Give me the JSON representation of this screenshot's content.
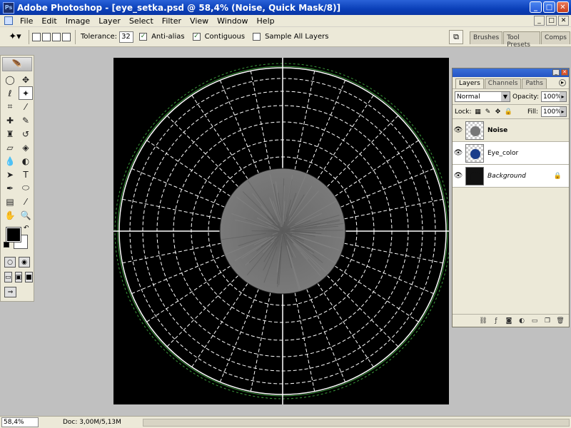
{
  "window": {
    "title": "Adobe Photoshop - [eye_setka.psd @ 58,4% (Noise, Quick Mask/8)]",
    "app_icon": "Ps",
    "minimize": "_",
    "maximize": "□",
    "close": "✕"
  },
  "menu": [
    "File",
    "Edit",
    "Image",
    "Layer",
    "Select",
    "Filter",
    "View",
    "Window",
    "Help"
  ],
  "doc_window_btns": [
    "_",
    "□",
    "✕"
  ],
  "options": {
    "tolerance_label": "Tolerance:",
    "tolerance_value": "32",
    "anti_alias_label": "Anti-alias",
    "anti_alias_checked": true,
    "contiguous_label": "Contiguous",
    "contiguous_checked": true,
    "sample_all_layers_label": "Sample All Layers",
    "sample_all_layers_checked": false
  },
  "palette_well": {
    "tabs": [
      "Brushes",
      "Tool Presets",
      "Comps"
    ]
  },
  "toolbox": {
    "tools": [
      {
        "name": "marquee-tool-icon",
        "glyph": "◯"
      },
      {
        "name": "move-tool-icon",
        "glyph": "✥"
      },
      {
        "name": "lasso-tool-icon",
        "glyph": "ℓ"
      },
      {
        "name": "magic-wand-tool-icon",
        "glyph": "✦",
        "active": true
      },
      {
        "name": "crop-tool-icon",
        "glyph": "⌗"
      },
      {
        "name": "slice-tool-icon",
        "glyph": "⁄"
      },
      {
        "name": "healing-brush-icon",
        "glyph": "✚"
      },
      {
        "name": "brush-tool-icon",
        "glyph": "✎"
      },
      {
        "name": "clone-stamp-icon",
        "glyph": "♜"
      },
      {
        "name": "history-brush-icon",
        "glyph": "↺"
      },
      {
        "name": "eraser-tool-icon",
        "glyph": "▱"
      },
      {
        "name": "paint-bucket-icon",
        "glyph": "◈"
      },
      {
        "name": "blur-tool-icon",
        "glyph": "💧"
      },
      {
        "name": "dodge-tool-icon",
        "glyph": "◐"
      },
      {
        "name": "path-selection-icon",
        "glyph": "➤"
      },
      {
        "name": "type-tool-icon",
        "glyph": "T"
      },
      {
        "name": "pen-tool-icon",
        "glyph": "✒"
      },
      {
        "name": "shape-tool-icon",
        "glyph": "⬭"
      },
      {
        "name": "notes-tool-icon",
        "glyph": "▤"
      },
      {
        "name": "eyedropper-tool-icon",
        "glyph": "⁄"
      },
      {
        "name": "hand-tool-icon",
        "glyph": "✋"
      },
      {
        "name": "zoom-tool-icon",
        "glyph": "🔍"
      }
    ],
    "feather_glyph": "🪶",
    "swap_glyph": "↶"
  },
  "layers_panel": {
    "tabs": [
      "Layers",
      "Channels",
      "Paths"
    ],
    "blend_mode": "Normal",
    "opacity_label": "Opacity:",
    "opacity_value": "100%",
    "lock_label": "Lock:",
    "fill_label": "Fill:",
    "fill_value": "100%",
    "layers": [
      {
        "name": "Noise",
        "visible": true,
        "selected": true,
        "style": "bold",
        "thumb_color": "#777777"
      },
      {
        "name": "Eye_color",
        "visible": true,
        "selected": false,
        "style": "normal",
        "thumb_color": "#1b3d8a"
      },
      {
        "name": "Background",
        "visible": true,
        "selected": false,
        "style": "italic",
        "thumb_color": "#111111",
        "locked": true
      }
    ],
    "footer_icons": [
      "link-icon",
      "layer-style-icon",
      "mask-icon",
      "adjustment-icon",
      "group-icon",
      "new-layer-icon",
      "trash-icon"
    ]
  },
  "status": {
    "zoom": "58,4%",
    "doc": "Doc: 3,00M/5,13M",
    "arrow": "▶"
  },
  "colors": {
    "grid_line": "#ffffff",
    "guide_green": "#3a9a3a",
    "canvas_bg": "#000000",
    "center_gray": "#777777"
  }
}
